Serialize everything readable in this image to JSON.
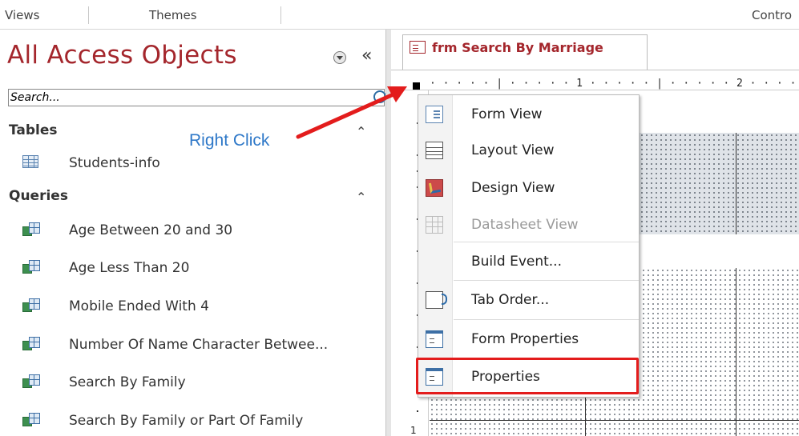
{
  "ribbon": {
    "groups": [
      "Views",
      "Themes",
      "Contro"
    ]
  },
  "nav": {
    "title": "All Access Objects",
    "search_placeholder": "Search...",
    "groups": [
      {
        "header": "Tables",
        "items": [
          "Students-info"
        ]
      },
      {
        "header": "Queries",
        "items": [
          "Age Between 20 and 30",
          "Age Less Than 20",
          "Mobile Ended With 4",
          "Number Of Name Character Betwee...",
          "Search By Family",
          "Search By Family or Part Of Family"
        ]
      }
    ]
  },
  "document": {
    "tab_label": "frm Search By Marriage",
    "ruler_text": "· · · · · | · · · · · 1 · · · · · | · · · · · 2 · · · ·",
    "vruler_label": "1"
  },
  "context_menu": {
    "items": [
      {
        "label": "Form View",
        "icon": "form-view-icon",
        "enabled": true
      },
      {
        "label": "Layout View",
        "icon": "layout-view-icon",
        "enabled": true
      },
      {
        "label": "Design View",
        "icon": "design-view-icon",
        "enabled": true
      },
      {
        "label": "Datasheet View",
        "icon": "datasheet-view-icon",
        "enabled": false
      },
      {
        "label": "Build Event...",
        "icon": "",
        "enabled": true
      },
      {
        "label": "Tab Order...",
        "icon": "tab-order-icon",
        "enabled": true
      },
      {
        "label": "Form Properties",
        "icon": "form-properties-icon",
        "enabled": true
      },
      {
        "label": "Properties",
        "icon": "properties-icon",
        "enabled": true
      }
    ],
    "highlighted": "Properties"
  },
  "annotation": {
    "text": "Right Click",
    "color": "#2e78c8",
    "arrow_color": "#e31c1c"
  },
  "colors": {
    "accent": "#a4262c",
    "highlight_border": "#e31c1c"
  }
}
